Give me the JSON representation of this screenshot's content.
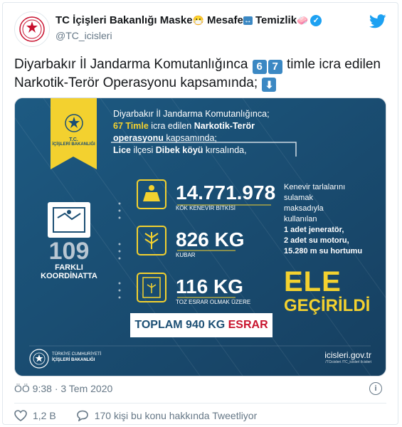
{
  "header": {
    "name_parts": [
      "TC İçişleri Bakanlığı Maske",
      "Mesafe",
      "Temizlik"
    ],
    "emojis": [
      "😷",
      "↔",
      "🧼"
    ],
    "handle": "@TC_icisleri"
  },
  "tweet": {
    "line1_start": "Diyarbakır İl Jandarma Komutanlığınca ",
    "digit1": "6",
    "digit2": "7",
    "line1_end": " timle icra edilen",
    "line2": "Narkotik-Terör Operasyonu kapsamında; ",
    "down_arrow": "⬇"
  },
  "infographic": {
    "ministry_top": "T.C.",
    "ministry_name": "İÇİŞLERİ BAKANLIĞI",
    "intro": [
      {
        "t": "Diyarbakır İl Jandarma Komutanlığınca;",
        "b": false
      },
      {
        "t": "67 Timle",
        "b": true
      },
      {
        "t": " icra edilen ",
        "b": false
      },
      {
        "t": "Narkotik-Terör",
        "b": true
      },
      {
        "t": "operasyonu",
        "b": true
      },
      {
        "t": " kapsamında;",
        "b": false
      },
      {
        "t": "Lice",
        "b": true
      },
      {
        "t": " ilçesi ",
        "b": false
      },
      {
        "t": "Dibek köyü",
        "b": true
      },
      {
        "t": " kırsalında,",
        "b": false
      }
    ],
    "coords_number": "109",
    "coords_label1": "FARKLI",
    "coords_label2": "KOORDİNATTA",
    "stats": [
      {
        "value": "14.771.978",
        "label": "KÖK KENEVİR BİTKİSİ"
      },
      {
        "value": "826 KG",
        "label": "KUBAR"
      },
      {
        "value": "116 KG",
        "label": "TOZ ESRAR OLMAK ÜZERE"
      }
    ],
    "total_prefix": "TOPLAM ",
    "total_value": "940 KG",
    "total_suffix": " ESRAR",
    "side_lines": [
      "Kenevir tarlalarını",
      "sulamak",
      "maksadıyla",
      "kullanılan"
    ],
    "side_bold": [
      "1 adet jeneratör,",
      "2 adet su motoru,",
      "15.280 m su hortumu"
    ],
    "ele": "ELE",
    "geçirildi": "GEÇİRİLDİ",
    "footer_ministry_line1": "TÜRKİYE CUMHURİYETİ",
    "footer_ministry_line2": "İÇİŞLERİ BAKANLIĞI",
    "website": "icisleri.gov.tr",
    "social": [
      "/TCicisleri",
      "/TC_icisleri",
      "/icisleri"
    ]
  },
  "meta": {
    "time": "ÖÖ 9:38",
    "dot": "·",
    "date": "3 Tem 2020",
    "likes": "1,2 B",
    "replies_text": "170 kişi bu konu hakkında Tweetliyor"
  },
  "colors": {
    "twitter_blue": "#1da1f2",
    "infographic_bg": "#1c4f74",
    "accent_yellow": "#f3d12f",
    "total_red": "#c8142e"
  }
}
